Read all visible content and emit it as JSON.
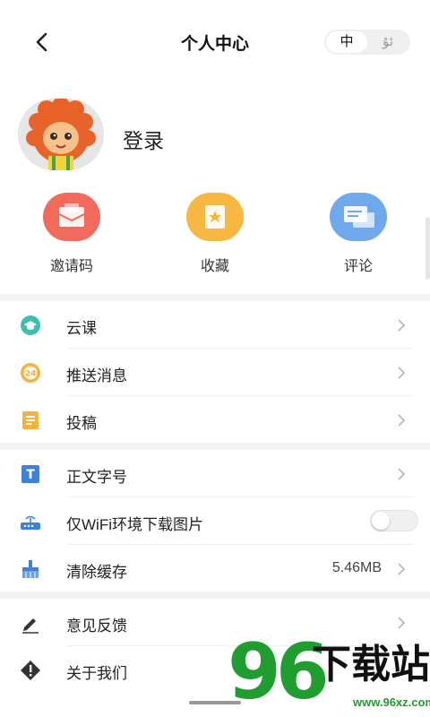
{
  "header": {
    "title": "个人中心",
    "lang_active": "中",
    "lang_other": "ئۇ"
  },
  "profile": {
    "login_label": "登录"
  },
  "actions": [
    {
      "label": "邀请码",
      "color": "#f26a5c"
    },
    {
      "label": "收藏",
      "color": "#f7b740"
    },
    {
      "label": "评论",
      "color": "#6fa8ec"
    }
  ],
  "menu": [
    {
      "label": "云课",
      "icon": "graduation-cap-icon",
      "icon_color": "#3cbfb0"
    },
    {
      "label": "推送消息",
      "icon": "push-badge-icon",
      "icon_color": "#f5b23c",
      "badge": "24"
    },
    {
      "label": "投稿",
      "icon": "document-icon",
      "icon_color": "#f5b23c"
    },
    {
      "label": "正文字号",
      "icon": "text-size-icon",
      "icon_color": "#3d82d8",
      "glyph": "T"
    },
    {
      "label": "仅WiFi环境下载图片",
      "icon": "router-icon",
      "icon_color": "#3d82d8",
      "toggle": false
    },
    {
      "label": "清除缓存",
      "icon": "broom-icon",
      "icon_color": "#3d82d8",
      "value": "5.46MB"
    },
    {
      "label": "意见反馈",
      "icon": "pen-icon",
      "icon_color": "#333333"
    },
    {
      "label": "关于我们",
      "icon": "info-diamond-icon",
      "icon_color": "#333333"
    }
  ],
  "watermark": {
    "number": "96",
    "text": "下载站",
    "url": "www.96xz.com"
  }
}
